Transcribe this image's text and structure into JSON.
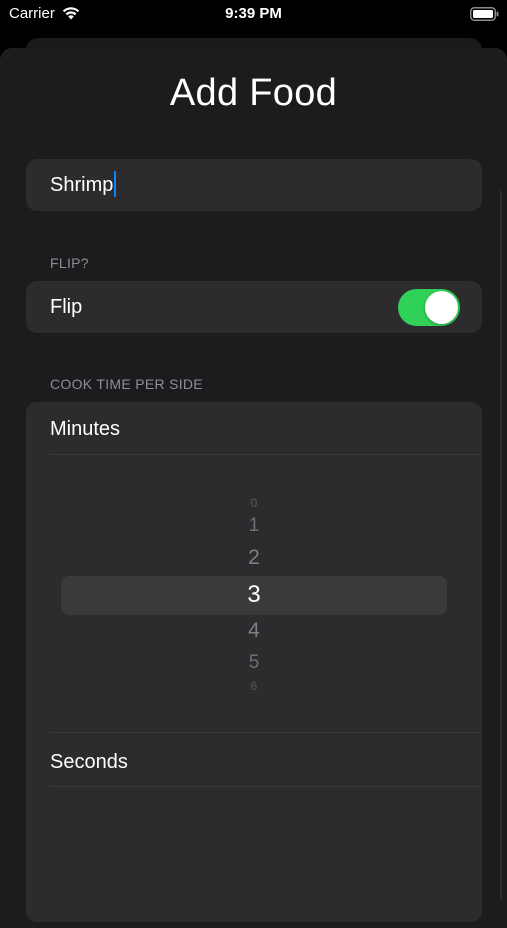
{
  "status_bar": {
    "carrier": "Carrier",
    "time": "9:39 PM",
    "wifi_icon": "wifi-icon",
    "battery_icon": "battery-icon"
  },
  "title": "Add Food",
  "name_field": {
    "value": "Shrimp"
  },
  "flip_section": {
    "header": "FLIP?",
    "label": "Flip",
    "toggle_on": true,
    "toggle_color": "#30d158"
  },
  "cook_time_section": {
    "header": "COOK TIME PER SIDE",
    "minutes_label": "Minutes",
    "minutes_picker": {
      "options": [
        "0",
        "1",
        "2",
        "3",
        "4",
        "5",
        "6"
      ],
      "selected": "3"
    },
    "seconds_label": "Seconds"
  },
  "colors": {
    "background": "#000000",
    "sheet": "#1c1c1e",
    "group": "#2c2c2e",
    "secondary_text": "#8e8e93",
    "caret": "#0a84ff"
  }
}
